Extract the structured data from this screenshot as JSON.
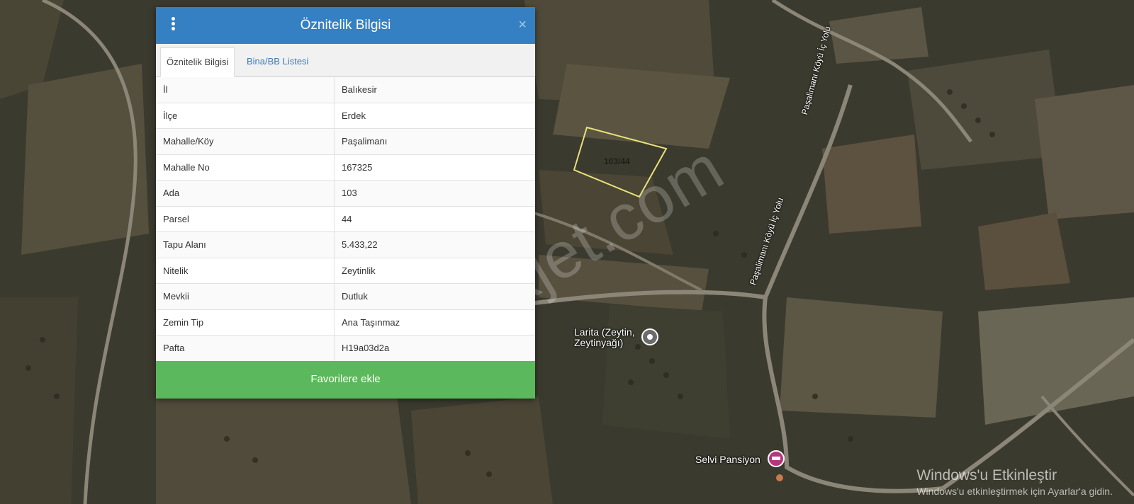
{
  "map": {
    "parcel_label": "103/44",
    "roads": [
      "Paşalimanı Köyü İç Yolu",
      "Paşalimanı Köyü İç Yolu"
    ],
    "pois": [
      {
        "label_line1": "Larita (Zeytin,",
        "label_line2": "Zeytinyağı)"
      },
      {
        "label_line1": "Selvi Pansiyon",
        "label_line2": ""
      }
    ],
    "watermark": "emlakjet.com",
    "activation_title": "Windows'u Etkinleştir",
    "activation_sub": "Windows'u etkinleştirmek için Ayarlar'a gidin."
  },
  "panel": {
    "title": "Öznitelik Bilgisi",
    "close_glyph": "×",
    "tabs": [
      {
        "label": "Öznitelik Bilgisi",
        "active": true
      },
      {
        "label": "Bina/BB Listesi",
        "active": false
      }
    ],
    "rows": [
      {
        "key": "İl",
        "value": "Balıkesir"
      },
      {
        "key": "İlçe",
        "value": "Erdek"
      },
      {
        "key": "Mahalle/Köy",
        "value": "Paşalimanı"
      },
      {
        "key": "Mahalle No",
        "value": "167325"
      },
      {
        "key": "Ada",
        "value": "103"
      },
      {
        "key": "Parsel",
        "value": "44"
      },
      {
        "key": "Tapu Alanı",
        "value": "5.433,22"
      },
      {
        "key": "Nitelik",
        "value": "Zeytinlik"
      },
      {
        "key": "Mevkii",
        "value": "Dutluk"
      },
      {
        "key": "Zemin Tip",
        "value": "Ana Taşınmaz"
      },
      {
        "key": "Pafta",
        "value": "H19a03d2a"
      }
    ],
    "favorite_button": "Favorilere ekle"
  },
  "colors": {
    "header": "#3580c2",
    "favorite": "#5cb85c",
    "tab_link": "#3a7abc",
    "parcel_outline": "#e8e07a"
  },
  "icons": [
    "menu-dots-icon",
    "close-icon",
    "location-pin-icon",
    "hotel-pin-icon"
  ]
}
